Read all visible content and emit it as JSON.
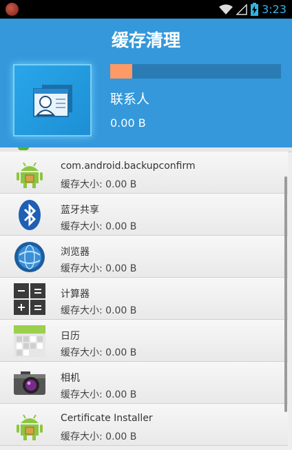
{
  "status_bar": {
    "time": "3:23"
  },
  "header": {
    "title": "缓存清理",
    "current_app": {
      "name": "联系人",
      "size": "0.00 B",
      "progress_percent": 13
    }
  },
  "list": {
    "items": [
      {
        "name": "com.android.backupconfirm",
        "size": "缓存大小: 0.00 B",
        "icon": "android-icon"
      },
      {
        "name": "蓝牙共享",
        "size": "缓存大小: 0.00 B",
        "icon": "bluetooth-icon"
      },
      {
        "name": "浏览器",
        "size": "缓存大小: 0.00 B",
        "icon": "browser-globe-icon"
      },
      {
        "name": "计算器",
        "size": "缓存大小: 0.00 B",
        "icon": "calculator-icon"
      },
      {
        "name": "日历",
        "size": "缓存大小: 0.00 B",
        "icon": "calendar-icon"
      },
      {
        "name": "相机",
        "size": "缓存大小: 0.00 B",
        "icon": "camera-icon"
      },
      {
        "name": "Certificate Installer",
        "size": "缓存大小: 0.00 B",
        "icon": "android-icon"
      }
    ]
  }
}
